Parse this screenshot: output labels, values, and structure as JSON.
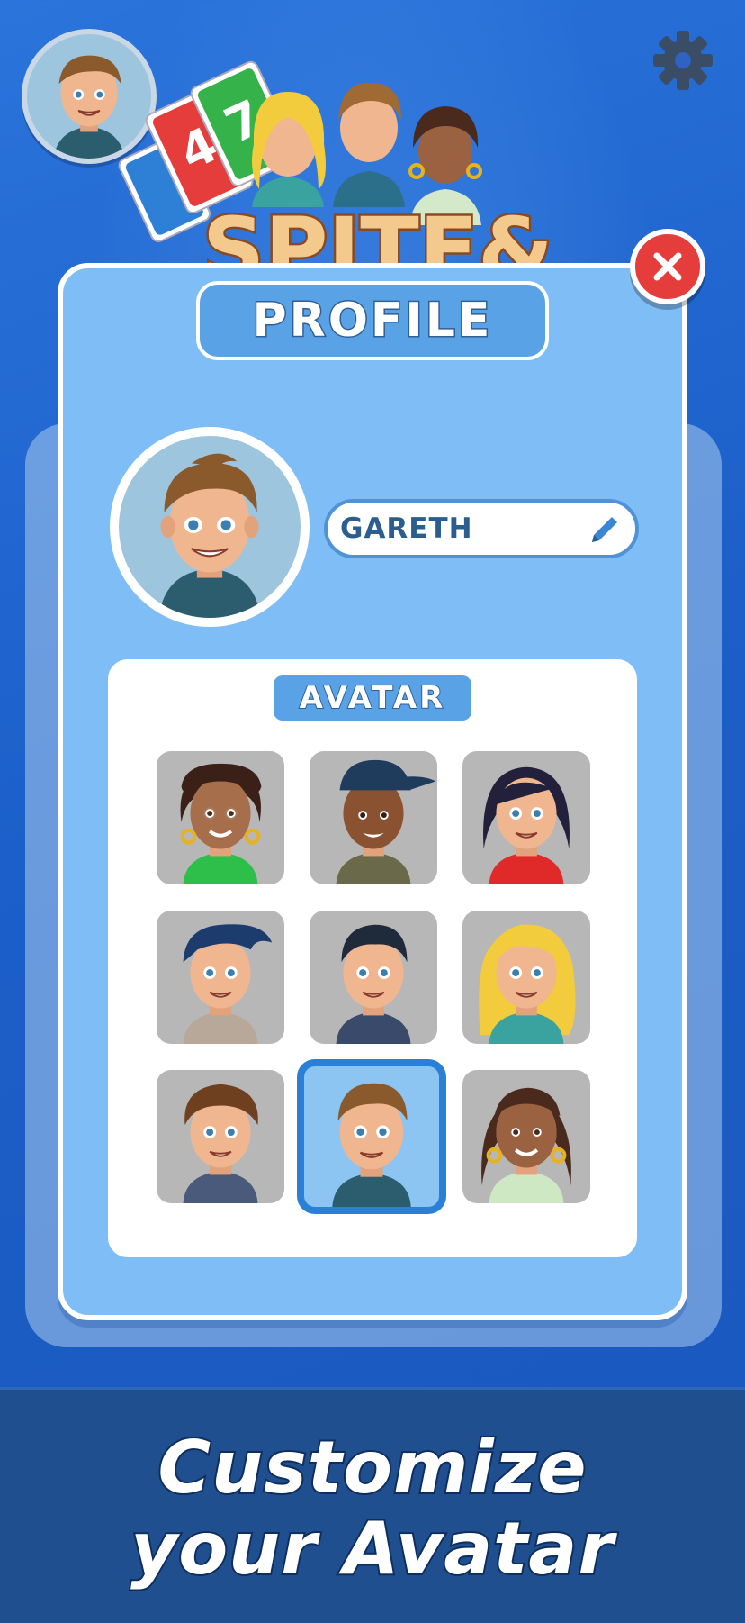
{
  "profile": {
    "title": "PROFILE",
    "player_name": "GARETH",
    "avatar_section_title": "AVATAR"
  },
  "logo": {
    "text": "SPITE&"
  },
  "avatars": [
    {
      "name": "woman-curly-dark"
    },
    {
      "name": "man-cap"
    },
    {
      "name": "woman-black-bob"
    },
    {
      "name": "man-blue-hair"
    },
    {
      "name": "man-dark-hair"
    },
    {
      "name": "woman-blonde"
    },
    {
      "name": "boy-curly-brown"
    },
    {
      "name": "gareth",
      "selected": true
    },
    {
      "name": "woman-bun"
    }
  ],
  "banner": {
    "line1": "Customize",
    "line2": "your Avatar"
  },
  "icons": {
    "settings": "gear-icon",
    "close": "close-icon",
    "edit": "pencil-icon"
  },
  "colors": {
    "background": "#1f5fc8",
    "card": "#7fbdf6",
    "accent": "#2a7fd6",
    "close": "#e53c3c",
    "banner": "#1f4f8f"
  }
}
